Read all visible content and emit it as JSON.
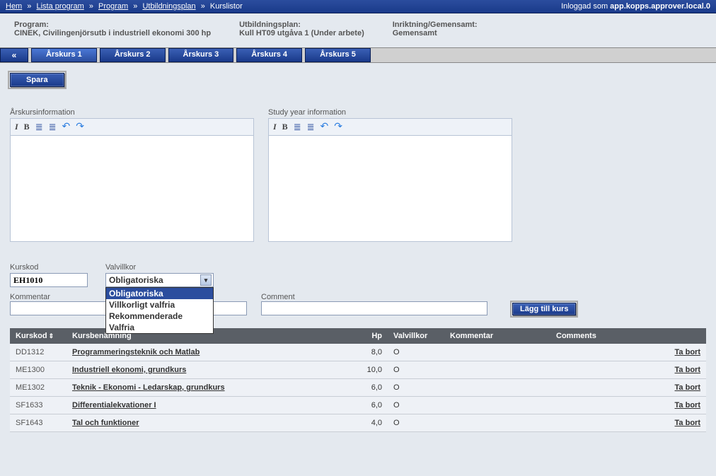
{
  "breadcrumbs": {
    "items": [
      "Hem",
      "Lista program",
      "Program",
      "Utbildningsplan"
    ],
    "current": "Kurslistor"
  },
  "login": {
    "prefix": "Inloggad som ",
    "user": "app.kopps.approver.local.0"
  },
  "header": {
    "program_label": "Program:",
    "program_value": "CINEK, Civilingenjörsutb i industriell ekonomi 300 hp",
    "utbplan_label": "Utbildningsplan:",
    "utbplan_value": "Kull HT09 utgåva 1 (Under arbete)",
    "inriktning_label": "Inriktning/Gemensamt:",
    "inriktning_value": "Gemensamt"
  },
  "tabs": {
    "back": "«",
    "items": [
      "Årskurs 1",
      "Årskurs 2",
      "Årskurs 3",
      "Årskurs 4",
      "Årskurs 5"
    ],
    "active": 0
  },
  "buttons": {
    "spara": "Spara",
    "add": "Lägg till kurs",
    "delete": "Ta bort"
  },
  "editors": {
    "left_label": "Årskursinformation",
    "right_label": "Study year information"
  },
  "form": {
    "kurskod_label": "Kurskod",
    "kurskod_value": "EH1010",
    "valvillkor_label": "Valvillkor",
    "valvillkor_selected": "Obligatoriska",
    "valvillkor_options": [
      "Obligatoriska",
      "Villkorligt valfria",
      "Rekommenderade",
      "Valfria"
    ],
    "kommentar_label": "Kommentar",
    "kommentar_value": "",
    "comment_label": "Comment",
    "comment_value": ""
  },
  "table": {
    "headers": {
      "kurskod": "Kurskod",
      "benamning": "Kursbenämning",
      "hp": "Hp",
      "valvillkor": "Valvillkor",
      "kommentar": "Kommentar",
      "comments": "Comments"
    },
    "rows": [
      {
        "code": "DD1312",
        "name": "Programmeringsteknik och Matlab",
        "hp": "8,0",
        "val": "O"
      },
      {
        "code": "ME1300",
        "name": "Industriell ekonomi, grundkurs",
        "hp": "10,0",
        "val": "O"
      },
      {
        "code": "ME1302",
        "name": "Teknik - Ekonomi - Ledarskap, grundkurs",
        "hp": "6,0",
        "val": "O"
      },
      {
        "code": "SF1633",
        "name": "Differentialekvationer I",
        "hp": "6,0",
        "val": "O"
      },
      {
        "code": "SF1643",
        "name": "Tal och funktioner",
        "hp": "4,0",
        "val": "O"
      }
    ]
  }
}
